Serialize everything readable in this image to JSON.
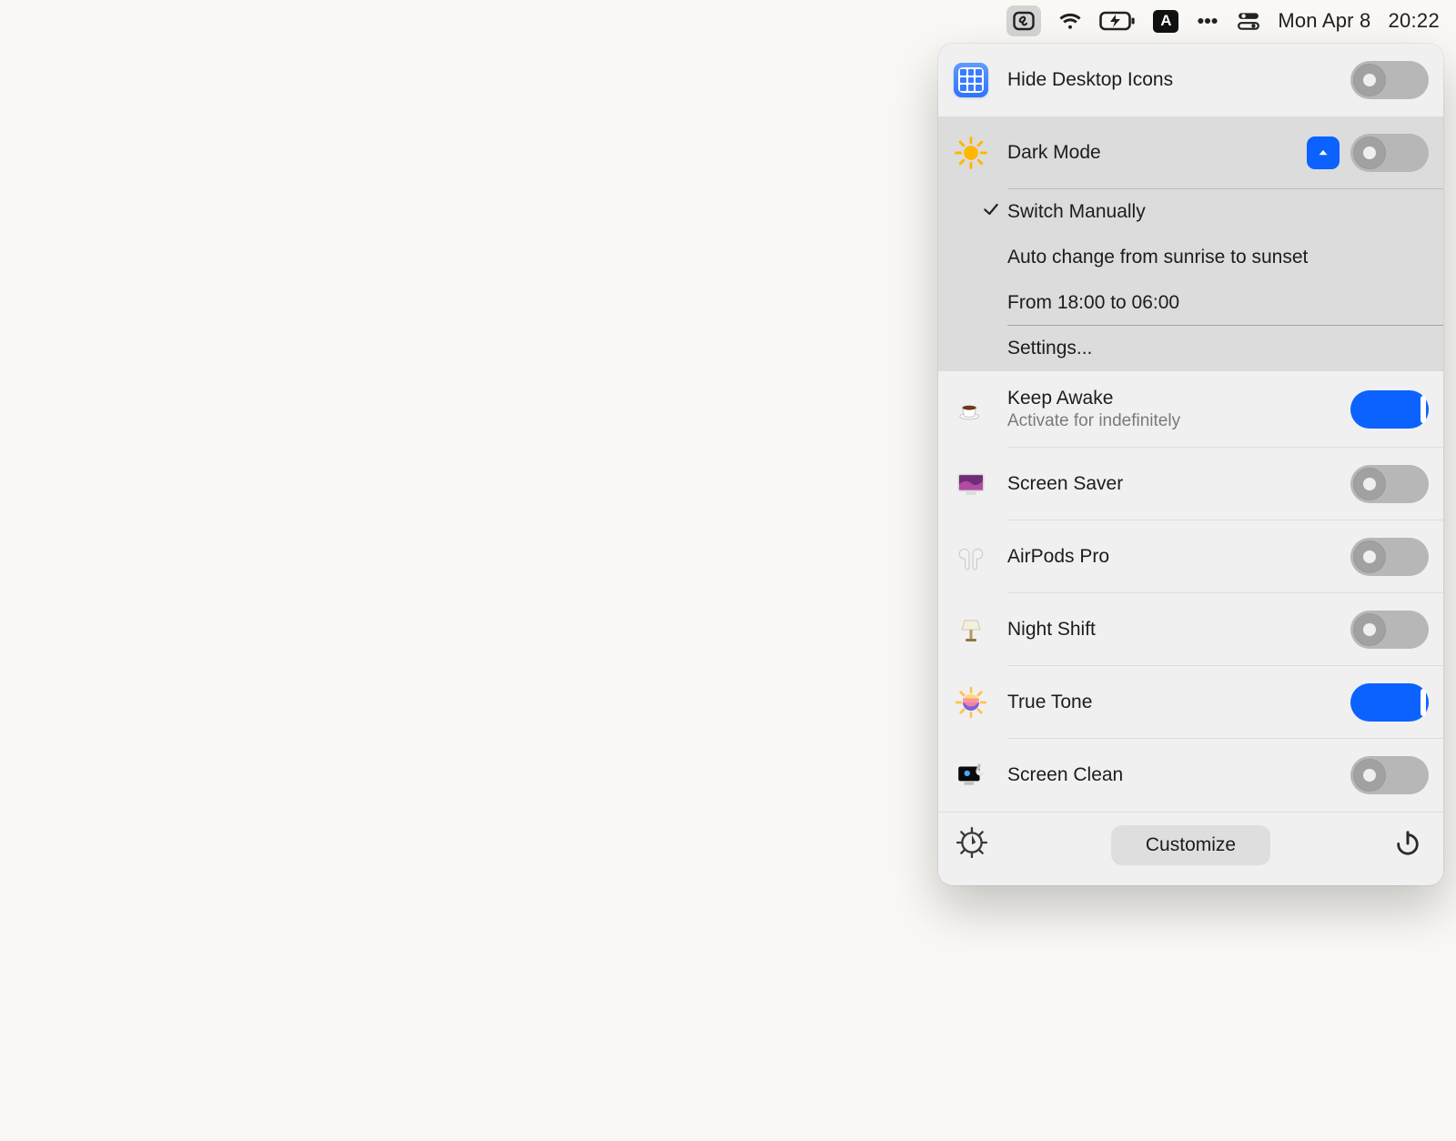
{
  "menubar": {
    "date": "Mon Apr 8",
    "time": "20:22",
    "keyboard_layout_letter": "A"
  },
  "panel": {
    "hide_desktop": {
      "label": "Hide Desktop Icons",
      "on": false
    },
    "dark_mode": {
      "label": "Dark Mode",
      "on": false,
      "options": {
        "switch_manually": "Switch Manually",
        "auto_sunrise": "Auto change from sunrise to sunset",
        "schedule": "From 18:00 to 06:00",
        "settings": "Settings..."
      },
      "selected": "switch_manually"
    },
    "keep_awake": {
      "label": "Keep Awake",
      "sublabel": "Activate for indefinitely",
      "on": true
    },
    "screen_saver": {
      "label": "Screen Saver",
      "on": false
    },
    "airpods": {
      "label": "AirPods Pro",
      "on": false
    },
    "night_shift": {
      "label": "Night Shift",
      "on": false
    },
    "true_tone": {
      "label": "True Tone",
      "on": true
    },
    "screen_clean": {
      "label": "Screen Clean",
      "on": false
    },
    "footer": {
      "customize": "Customize"
    }
  }
}
